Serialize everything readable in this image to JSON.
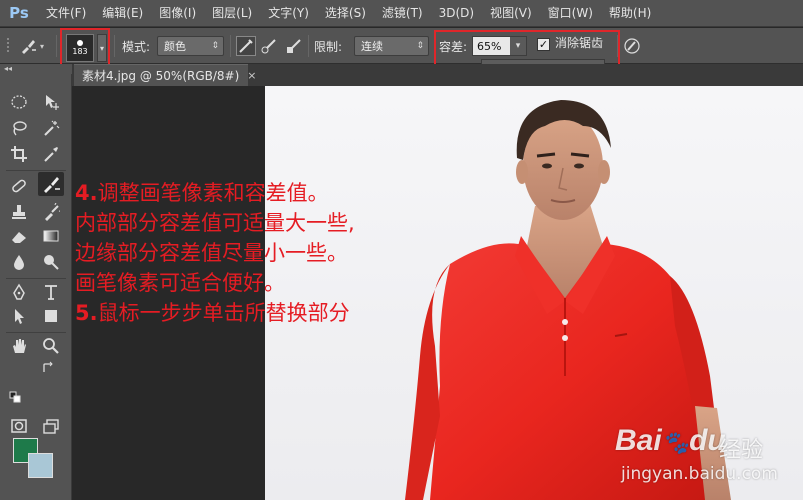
{
  "app": {
    "logo": "Ps"
  },
  "menu": [
    "文件(F)",
    "编辑(E)",
    "图像(I)",
    "图层(L)",
    "文字(Y)",
    "选择(S)",
    "滤镜(T)",
    "3D(D)",
    "视图(V)",
    "窗口(W)",
    "帮助(H)"
  ],
  "options": {
    "brush_size": "183",
    "mode_label": "模式:",
    "mode_value": "颜色",
    "limit_label": "限制:",
    "limit_value": "连续",
    "tolerance_label": "容差:",
    "tolerance_value": "65%",
    "tolerance_level": 0.65,
    "antialias_label": "消除锯齿",
    "antialias_checked": true
  },
  "document": {
    "tab_title": "素材4.jpg @ 50%(RGB/8#)",
    "close_glyph": "×"
  },
  "colors": {
    "foreground": "#1e7a4a",
    "background": "#a9c7d6",
    "accent": "#e51c23"
  },
  "annotations": [
    {
      "num": "4.",
      "text": "调整画笔像素和容差值。"
    },
    {
      "num": "",
      "text": "内部部分容差值可适量大一些,"
    },
    {
      "num": "",
      "text": "边缘部分容差值尽量小一些。"
    },
    {
      "num": "",
      "text": "画笔像素可适合便好。"
    },
    {
      "num": "5.",
      "text": "鼠标一步步单击所替换部分"
    }
  ],
  "watermark": {
    "logo": "Bai",
    "logo_mid": "du",
    "cn": "经验",
    "url": "jingyan.baidu.com"
  }
}
